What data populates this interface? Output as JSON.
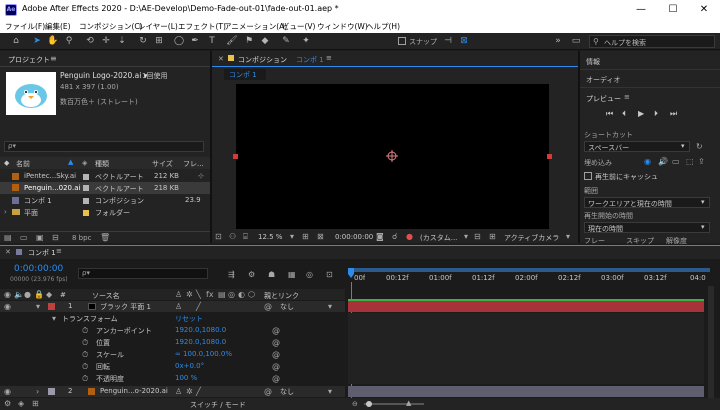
{
  "window": {
    "logo": "Ae",
    "title": "Adobe After Effects 2020 - D:\\AE-Develop\\Demo-Fade-out-01\\fade-out-01.aep *",
    "minimize": "—",
    "maximize": "☐",
    "close": "✕"
  },
  "menu": [
    "ファイル(F)",
    "編集(E)",
    "コンポジション(C)",
    "レイヤー(L)",
    "エフェクト(T)",
    "アニメーション(A)",
    "ビュー(V)",
    "ウィンドウ(W)",
    "ヘルプ(H)"
  ],
  "toolbar": {
    "snap_label": "スナップ",
    "search_placeholder": "ヘルプを検索"
  },
  "project": {
    "title": "プロジェクト",
    "menu_icon": "≡",
    "preview_name": "Penguin Logo-2020.ai ▾",
    "usage": "1回使用",
    "dims": "481 x 397 (1.00)",
    "colors": "数百万色＋ (ストレート)",
    "search_placeholder": "ρ▾",
    "headers": {
      "name": "名前",
      "type": "種類",
      "size": "サイズ",
      "fr": "フレ..."
    },
    "items": [
      {
        "name": "iPentec...Sky.ai",
        "type": "ベクトルアート",
        "size": "212 KB",
        "fr": "",
        "color": "#b4b4b4",
        "selected": false
      },
      {
        "name": "Penguin...020.ai",
        "type": "ベクトルアート",
        "size": "218 KB",
        "fr": "",
        "color": "#b4b4b4",
        "selected": true
      },
      {
        "name": "コンポ 1",
        "type": "コンポジション",
        "size": "",
        "fr": "23.9",
        "color": "#b4b4b4",
        "selected": false
      },
      {
        "name": "平面",
        "type": "フォルダー",
        "size": "",
        "fr": "",
        "color": "#e6c34a",
        "selected": false
      }
    ],
    "bpc": "8 bpc"
  },
  "composition": {
    "title": "コンポジション",
    "comp_name": "コンポ 1",
    "tab": "コンポ 1",
    "zoom": "12.5 %",
    "timecode": "0:00:00:00",
    "quality": "(カスタム...",
    "camera": "アクティブカメラ"
  },
  "right_panel": {
    "info": "情報",
    "audio": "オーディオ",
    "preview": "プレビュー",
    "shortcut_label": "ショートカット",
    "shortcut_value": "スペースバー",
    "include_label": "埋め込み",
    "cache_label": "再生前にキャッシュ",
    "range_label": "範囲",
    "range_value": "ワークエリアと現在の時間",
    "playfrom_label": "再生開始の時間",
    "playfrom_value": "現在の時間",
    "frame_label": "フレー",
    "skip_label": "スキップ",
    "res_label": "解像度"
  },
  "timeline": {
    "tab": "コンポ 1",
    "timecode": "0:00:00:00",
    "subtime": "00000 (23.976 fps)",
    "search_placeholder": "ρ▾",
    "col_source": "ソース名",
    "col_parent": "親とリンク",
    "ruler": [
      "00f",
      "00:12f",
      "01:00f",
      "01:12f",
      "02:00f",
      "02:12f",
      "03:00f",
      "03:12f",
      "04:0"
    ],
    "layers": [
      {
        "num": "1",
        "name": "ブラック 平面 1",
        "parent": "なし"
      },
      {
        "num": "2",
        "name": "Penguin...o-2020.ai",
        "parent": "なし"
      }
    ],
    "transform_label": "トランスフォーム",
    "reset_label": "リセット",
    "props": [
      {
        "name": "アンカーポイント",
        "value": "1920.0,1080.0"
      },
      {
        "name": "位置",
        "value": "1920.0,1080.0"
      },
      {
        "name": "スケール",
        "value": "∞ 100.0,100.0%"
      },
      {
        "name": "回転",
        "value": "0x+0.0°"
      },
      {
        "name": "不透明度",
        "value": "100 %"
      }
    ],
    "switch_mode": "スイッチ / モード"
  },
  "colors": {
    "accent": "#2d8ceb",
    "layer_red": "#a8323a",
    "layer_gray": "#5e5e6e",
    "timeline_bg": "#1b1b1b"
  }
}
